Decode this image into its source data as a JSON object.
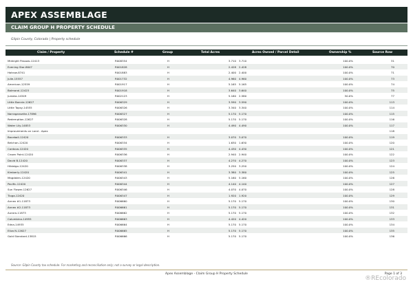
{
  "header": {
    "title": "APEX ASSEMBLAGE",
    "subtitle": "CLAIM GROUP H PROPERTY SCHEDULE"
  },
  "meta": "Gilpin County, Colorado | Property schedule",
  "table": {
    "columns": [
      "Claim / Property",
      "Schedule #",
      "Group",
      "Total Acres",
      "Acres Owned / Parcel Detail",
      "Ownership %",
      "Source Row"
    ],
    "rows": [
      [
        "Midnight Passow-12413",
        "R008354",
        "H",
        "3.710",
        "3.710",
        "100.0%",
        "31"
      ],
      [
        "Evening Star-8647",
        "R001828",
        "H",
        "2.428",
        "2.428",
        "100.0%",
        "70"
      ],
      [
        "Hotrow-8741",
        "R001883",
        "H",
        "2.400",
        "2.400",
        "100.0%",
        "71"
      ],
      [
        "Julie-15557",
        "R001732",
        "H",
        "4.960",
        "4.960",
        "100.0%",
        "73"
      ],
      [
        "American-12559",
        "R001917",
        "H",
        "5.165",
        "5.165",
        "100.0%",
        "74"
      ],
      [
        "Balmoral-12423",
        "R001918",
        "H",
        "3.640",
        "3.640",
        "100.0%",
        "75"
      ],
      [
        "Juniata-14349",
        "R002123",
        "H",
        "5.160",
        "2.580",
        "50.0%",
        "77"
      ],
      [
        "Little Bonnie-12627",
        "R006329",
        "H",
        "3.590",
        "3.590",
        "100.0%",
        "113"
      ],
      [
        "Little Topsy-14555",
        "R006326",
        "H",
        "3.340",
        "3.340",
        "100.0%",
        "114"
      ],
      [
        "Narragansette-17896",
        "R006327",
        "H",
        "5.170",
        "5.170",
        "100.0%",
        "115"
      ],
      [
        "Redemption-12627",
        "R006328",
        "H",
        "5.170",
        "5.170",
        "100.0%",
        "116"
      ],
      [
        "Water Lily-14853",
        "R006330",
        "H",
        "4.490",
        "4.490",
        "100.0%",
        "117"
      ],
      [
        "Improvements on Land - Apex",
        "",
        "",
        "",
        "",
        "",
        "118"
      ],
      [
        "Baceball-12420",
        "R006333",
        "H",
        "3.070",
        "3.070",
        "100.0%",
        "119"
      ],
      [
        "Belchan-12420",
        "R006334",
        "H",
        "1.630",
        "1.630",
        "100.0%",
        "120"
      ],
      [
        "Cordova-12420",
        "R006335",
        "H",
        "4.430",
        "4.430",
        "100.0%",
        "121"
      ],
      [
        "Crown Point-12420",
        "R006336",
        "H",
        "2.940",
        "2.940",
        "100.0%",
        "122"
      ],
      [
        "David B-12420",
        "R006337",
        "H",
        "4.270",
        "4.270",
        "100.0%",
        "123"
      ],
      [
        "Hildalgo-12420",
        "R006338",
        "H",
        "3.250",
        "3.250",
        "100.0%",
        "124"
      ],
      [
        "Kimberly-12420",
        "R006341",
        "H",
        "3.380",
        "3.380",
        "100.0%",
        "125"
      ],
      [
        "Magdalen-12420",
        "R006343",
        "H",
        "5.160",
        "5.160",
        "100.0%",
        "126"
      ],
      [
        "Pacific-12420",
        "R006344",
        "H",
        "4.140",
        "4.140",
        "100.0%",
        "127"
      ],
      [
        "Sun Flower-12627",
        "R006346",
        "H",
        "4.070",
        "4.070",
        "100.0%",
        "128"
      ],
      [
        "Tioga-12420",
        "R006347",
        "H",
        "1.920",
        "1.920",
        "100.0%",
        "129"
      ],
      [
        "Annex #1-11873",
        "R006660",
        "H",
        "5.170",
        "5.170",
        "100.0%",
        "130"
      ],
      [
        "Annex #2-11873",
        "R006661",
        "H",
        "5.170",
        "5.170",
        "100.0%",
        "131"
      ],
      [
        "Aurora-11873",
        "R006662",
        "H",
        "5.170",
        "5.170",
        "100.0%",
        "132"
      ],
      [
        "Columbina-14955",
        "R006663",
        "H",
        "4.420",
        "4.420",
        "100.0%",
        "133"
      ],
      [
        "Edna-14935",
        "R006664",
        "H",
        "5.170",
        "5.170",
        "100.0%",
        "134"
      ],
      [
        "Eliza N-12627",
        "R006665",
        "H",
        "5.170",
        "5.170",
        "100.0%",
        "135"
      ],
      [
        "Gold Standard-13815",
        "R006666",
        "H",
        "5.170",
        "5.170",
        "100.0%",
        "136"
      ]
    ]
  },
  "footer": {
    "note": "Source: Gilpin County tax schedule. For marketing and reconciliation only; not a survey or legal description.",
    "title": "Apex Assemblage - Claim Group H Property Schedule",
    "page": "Page 1 of 3"
  },
  "watermark": "®REcolorado"
}
